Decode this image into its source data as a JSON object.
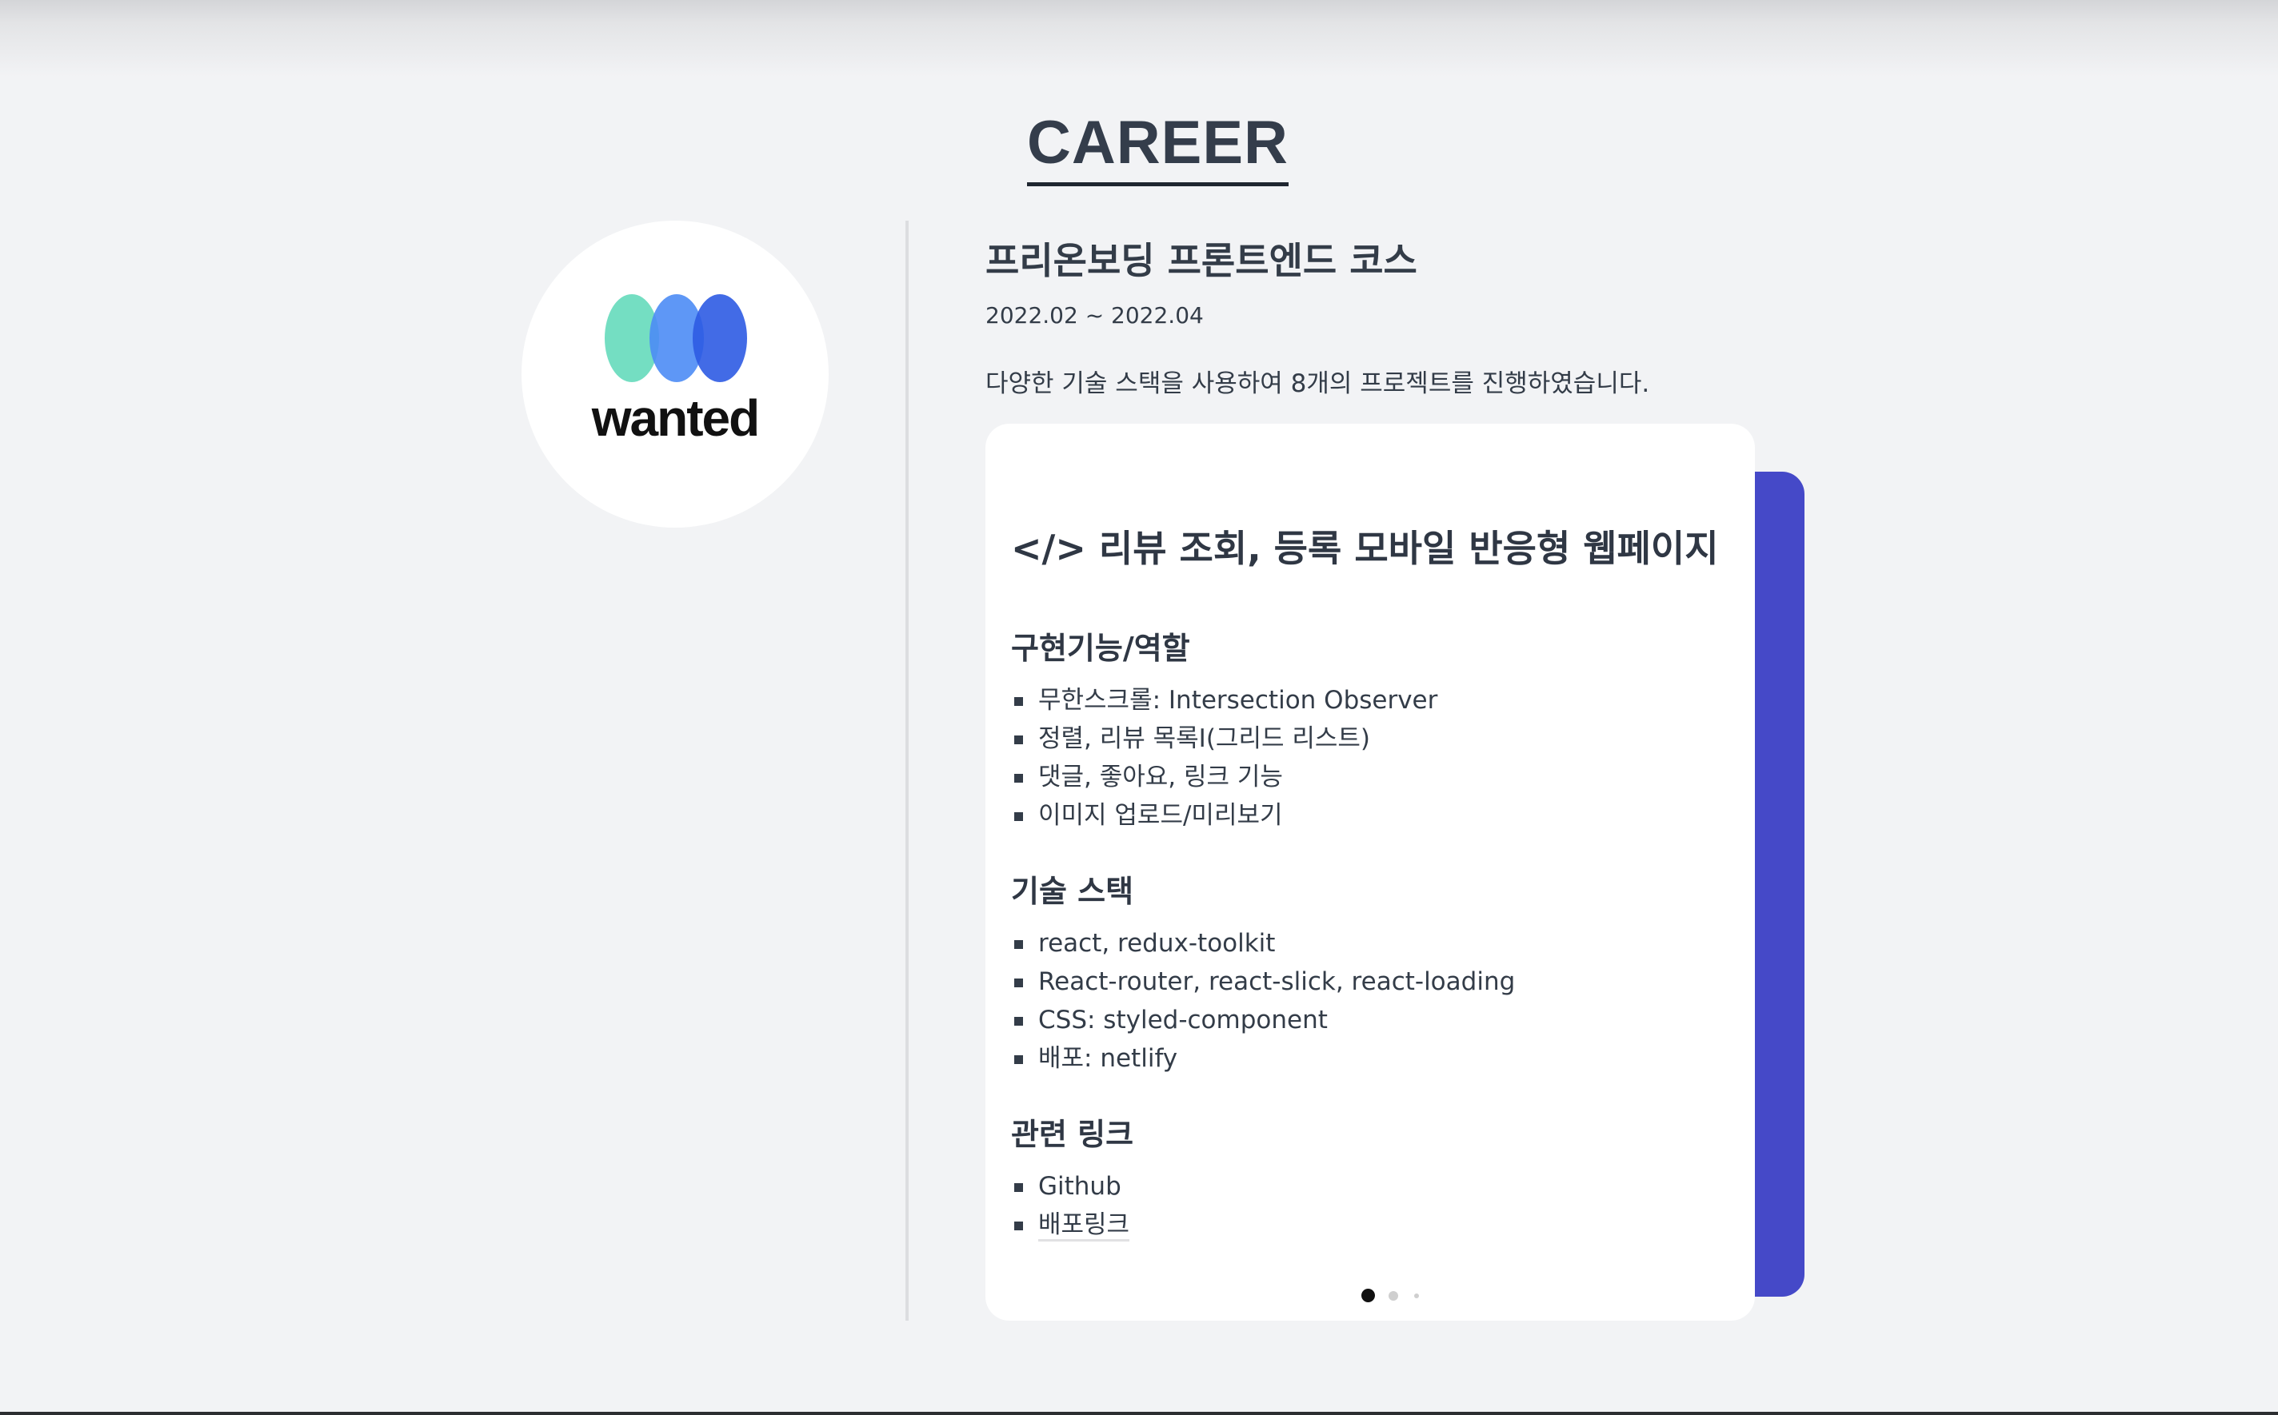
{
  "section": {
    "title": "CAREER"
  },
  "company": {
    "logo_text": "wanted",
    "logo_colors": [
      "#6ddcbf",
      "#4d8cf5",
      "#2d5be3"
    ]
  },
  "job": {
    "title": "프리온보딩 프론트엔드 코스",
    "period": "2022.02 ~ 2022.04",
    "description": "다양한 기술 스택을 사용하여 8개의 프로젝트를 진행하였습니다."
  },
  "project_card": {
    "heading": "</> 리뷰 조회, 등록 모바일 반응형 웹페이지",
    "features_title": "구현기능/역할",
    "features": [
      "무한스크롤: Intersection Observer",
      "정렬, 리뷰 목록I(그리드 리스트)",
      "댓글, 좋아요, 링크 기능",
      "이미지 업로드/미리보기"
    ],
    "stack_title": "기술 스택",
    "stack": [
      "react, redux-toolkit",
      "React-router, react-slick, react-loading",
      "CSS: styled-component",
      "배포: netlify"
    ],
    "links_title": "관련 링크",
    "links": [
      "Github",
      "배포링크"
    ]
  },
  "carousel": {
    "active_index": 1,
    "count": 3
  },
  "colors": {
    "accent": "#4549c8",
    "background": "#f2f3f5",
    "text": "#333c48"
  }
}
